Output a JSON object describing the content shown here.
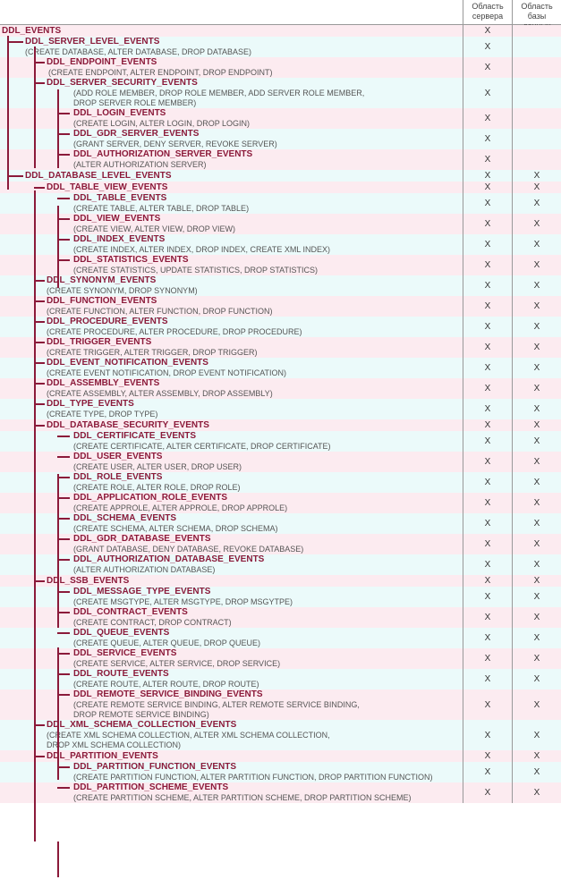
{
  "headers": {
    "col1": "Область сервера",
    "col2": "Область базы данных"
  },
  "x": "X",
  "rows": {
    "r0": {
      "title": "DDL_EVENTS"
    },
    "r1": {
      "title": "DDL_SERVER_LEVEL_EVENTS",
      "desc": "(CREATE DATABASE, ALTER DATABASE, DROP DATABASE)"
    },
    "r2": {
      "title": "DDL_ENDPOINT_EVENTS",
      "desc": "(CREATE ENDPOINT, ALTER ENDPOINT, DROP ENDPOINT)"
    },
    "r3": {
      "title": "DDL_SERVER_SECURITY_EVENTS",
      "desc": "(ADD ROLE MEMBER, DROP ROLE MEMBER, ADD SERVER ROLE MEMBER,",
      "desc2": " DROP SERVER ROLE MEMBER)"
    },
    "r4": {
      "title": "DDL_LOGIN_EVENTS",
      "desc": "(CREATE LOGIN, ALTER LOGIN, DROP LOGIN)"
    },
    "r5": {
      "title": "DDL_GDR_SERVER_EVENTS",
      "desc": "(GRANT SERVER, DENY SERVER, REVOKE SERVER)"
    },
    "r6": {
      "title": "DDL_AUTHORIZATION_SERVER_EVENTS",
      "desc": "(ALTER AUTHORIZATION SERVER)"
    },
    "r7": {
      "title": "DDL_DATABASE_LEVEL_EVENTS"
    },
    "r8": {
      "title": "DDL_TABLE_VIEW_EVENTS"
    },
    "r9": {
      "title": "DDL_TABLE_EVENTS",
      "desc": "(CREATE TABLE, ALTER TABLE, DROP TABLE)"
    },
    "r10": {
      "title": "DDL_VIEW_EVENTS",
      "desc": "(CREATE VIEW, ALTER VIEW, DROP VIEW)"
    },
    "r11": {
      "title": "DDL_INDEX_EVENTS",
      "desc": "(CREATE INDEX, ALTER INDEX, DROP INDEX, CREATE XML INDEX)"
    },
    "r12": {
      "title": "DDL_STATISTICS_EVENTS",
      "desc": "(CREATE STATISTICS, UPDATE STATISTICS, DROP STATISTICS)"
    },
    "r13": {
      "title": "DDL_SYNONYM_EVENTS",
      "desc": "(CREATE SYNONYM, DROP SYNONYM)"
    },
    "r14": {
      "title": "DDL_FUNCTION_EVENTS",
      "desc": "(CREATE FUNCTION, ALTER FUNCTION, DROP FUNCTION)"
    },
    "r15": {
      "title": "DDL_PROCEDURE_EVENTS",
      "desc": "(CREATE PROCEDURE, ALTER PROCEDURE, DROP PROCEDURE)"
    },
    "r16": {
      "title": "DDL_TRIGGER_EVENTS",
      "desc": "(CREATE TRIGGER, ALTER TRIGGER, DROP TRIGGER)"
    },
    "r17": {
      "title": "DDL_EVENT_NOTIFICATION_EVENTS",
      "desc": "(CREATE EVENT NOTIFICATION, DROP EVENT NOTIFICATION)"
    },
    "r18": {
      "title": "DDL_ASSEMBLY_EVENTS",
      "desc": "(CREATE ASSEMBLY, ALTER ASSEMBLY, DROP ASSEMBLY)"
    },
    "r19": {
      "title": "DDL_TYPE_EVENTS",
      "desc": "(CREATE TYPE, DROP TYPE)"
    },
    "r20": {
      "title": "DDL_DATABASE_SECURITY_EVENTS"
    },
    "r21": {
      "title": "DDL_CERTIFICATE_EVENTS",
      "desc": "(CREATE CERTIFICATE, ALTER CERTIFICATE, DROP CERTIFICATE)"
    },
    "r22": {
      "title": "DDL_USER_EVENTS",
      "desc": "(CREATE USER, ALTER USER, DROP USER)"
    },
    "r23": {
      "title": "DDL_ROLE_EVENTS",
      "desc": "(CREATE ROLE, ALTER ROLE, DROP ROLE)"
    },
    "r24": {
      "title": "DDL_APPLICATION_ROLE_EVENTS",
      "desc": "(CREATE APPROLE, ALTER APPROLE, DROP APPROLE)"
    },
    "r25": {
      "title": "DDL_SCHEMA_EVENTS",
      "desc": "(CREATE SCHEMA, ALTER SCHEMA, DROP SCHEMA)"
    },
    "r26": {
      "title": "DDL_GDR_DATABASE_EVENTS",
      "desc": "(GRANT DATABASE, DENY DATABASE, REVOKE DATABASE)"
    },
    "r27": {
      "title": "DDL_AUTHORIZATION_DATABASE_EVENTS",
      "desc": "(ALTER AUTHORIZATION DATABASE)"
    },
    "r28": {
      "title": "DDL_SSB_EVENTS"
    },
    "r29": {
      "title": "DDL_MESSAGE_TYPE_EVENTS",
      "desc": "(CREATE MSGTYPE, ALTER MSGTYPE, DROP MSGYTPE)"
    },
    "r30": {
      "title": "DDL_CONTRACT_EVENTS",
      "desc": "(CREATE CONTRACT, DROP CONTRACT)"
    },
    "r31": {
      "title": "DDL_QUEUE_EVENTS",
      "desc": "(CREATE QUEUE, ALTER QUEUE, DROP QUEUE)"
    },
    "r32": {
      "title": "DDL_SERVICE_EVENTS",
      "desc": "(CREATE SERVICE, ALTER SERVICE, DROP SERVICE)"
    },
    "r33": {
      "title": "DDL_ROUTE_EVENTS",
      "desc": "(CREATE ROUTE, ALTER ROUTE, DROP ROUTE)"
    },
    "r34": {
      "title": "DDL_REMOTE_SERVICE_BINDING_EVENTS",
      "desc": "(CREATE REMOTE SERVICE BINDING, ALTER REMOTE SERVICE BINDING,",
      "desc2": " DROP REMOTE SERVICE BINDING)"
    },
    "r35": {
      "title": "DDL_XML_SCHEMA_COLLECTION_EVENTS",
      "desc": "(CREATE XML SCHEMA COLLECTION, ALTER XML SCHEMA COLLECTION,",
      "desc2": " DROP XML SCHEMA COLLECTION)"
    },
    "r36": {
      "title": "DDL_PARTITION_EVENTS"
    },
    "r37": {
      "title": "DDL_PARTITION_FUNCTION_EVENTS",
      "desc": "(CREATE PARTITION FUNCTION, ALTER PARTITION FUNCTION, DROP PARTITION FUNCTION)"
    },
    "r38": {
      "title": "DDL_PARTITION_SCHEME_EVENTS",
      "desc": "(CREATE PARTITION SCHEME, ALTER PARTITION SCHEME, DROP PARTITION SCHEME)"
    }
  }
}
